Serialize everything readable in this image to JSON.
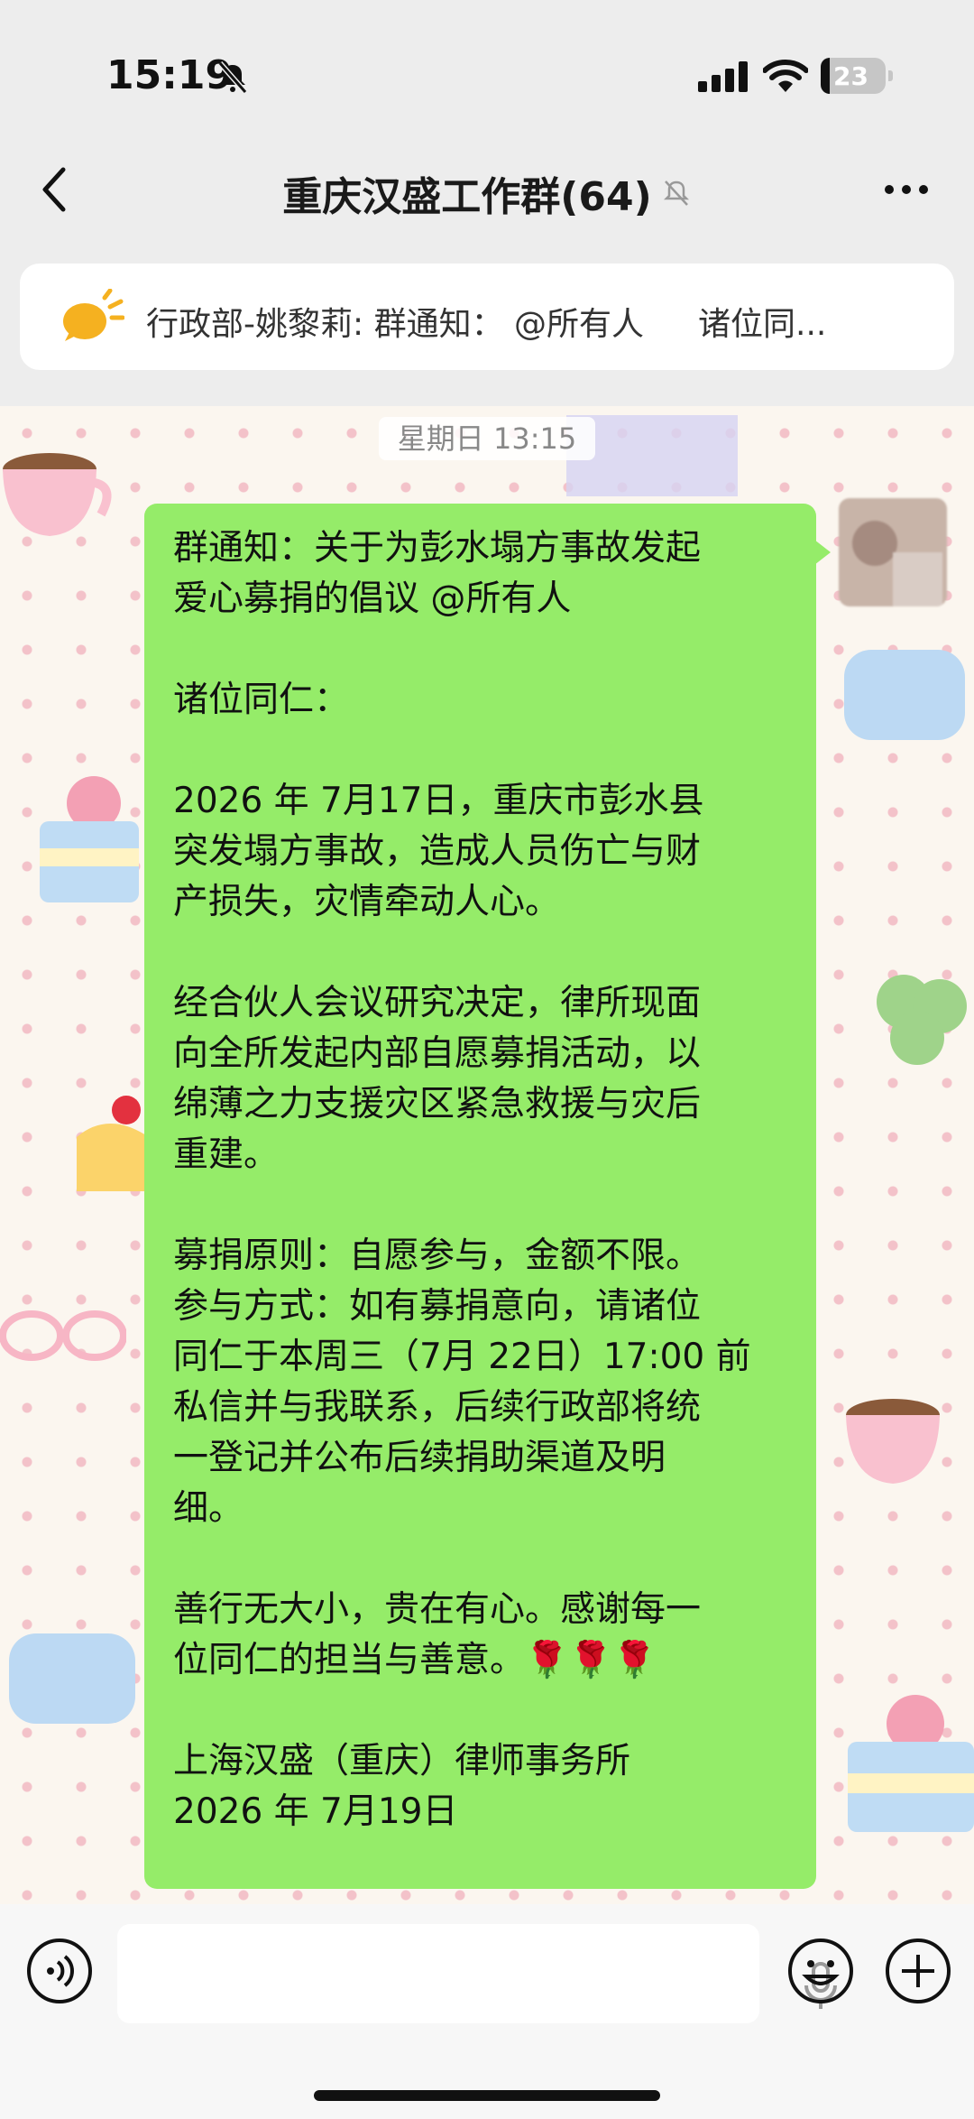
{
  "status_bar": {
    "time": "15:19",
    "battery": "23"
  },
  "header": {
    "title": "重庆汉盛工作群(64)"
  },
  "notice": {
    "text": "行政部-姚黎莉: 群通知： @所有人",
    "text_tail": "诸位同..."
  },
  "chat": {
    "timestamp": "星期日 13:15",
    "message": {
      "lines": [
        "群通知：关于为彭水塌方事故发起",
        "爱心募捐的倡议 @所有人",
        "",
        "诸位同仁：",
        "",
        "2026 年 7月17日，重庆市彭水县",
        "突发塌方事故，造成人员伤亡与财",
        "产损失，灾情牵动人心。",
        "",
        "经合伙人会议研究决定，律所现面",
        "向全所发起内部自愿募捐活动，以",
        "绵薄之力支援灾区紧急救援与灾后",
        "重建。",
        "",
        "募捐原则：自愿参与，金额不限。",
        "参与方式：如有募捐意向，请诸位",
        "同仁于本周三（7月 22日）17:00 前",
        "私信并与我联系，后续行政部将统",
        "一登记并公布后续捐助渠道及明",
        "细。",
        "",
        "善行无大小，贵在有心。感谢每一",
        "位同仁的担当与善意。🌹🌹🌹",
        "",
        "上海汉盛（重庆）律师事务所",
        "2026 年 7月19日"
      ]
    }
  },
  "colors": {
    "bubble": "#95ec69",
    "chat_bg": "#fbf6ef"
  }
}
